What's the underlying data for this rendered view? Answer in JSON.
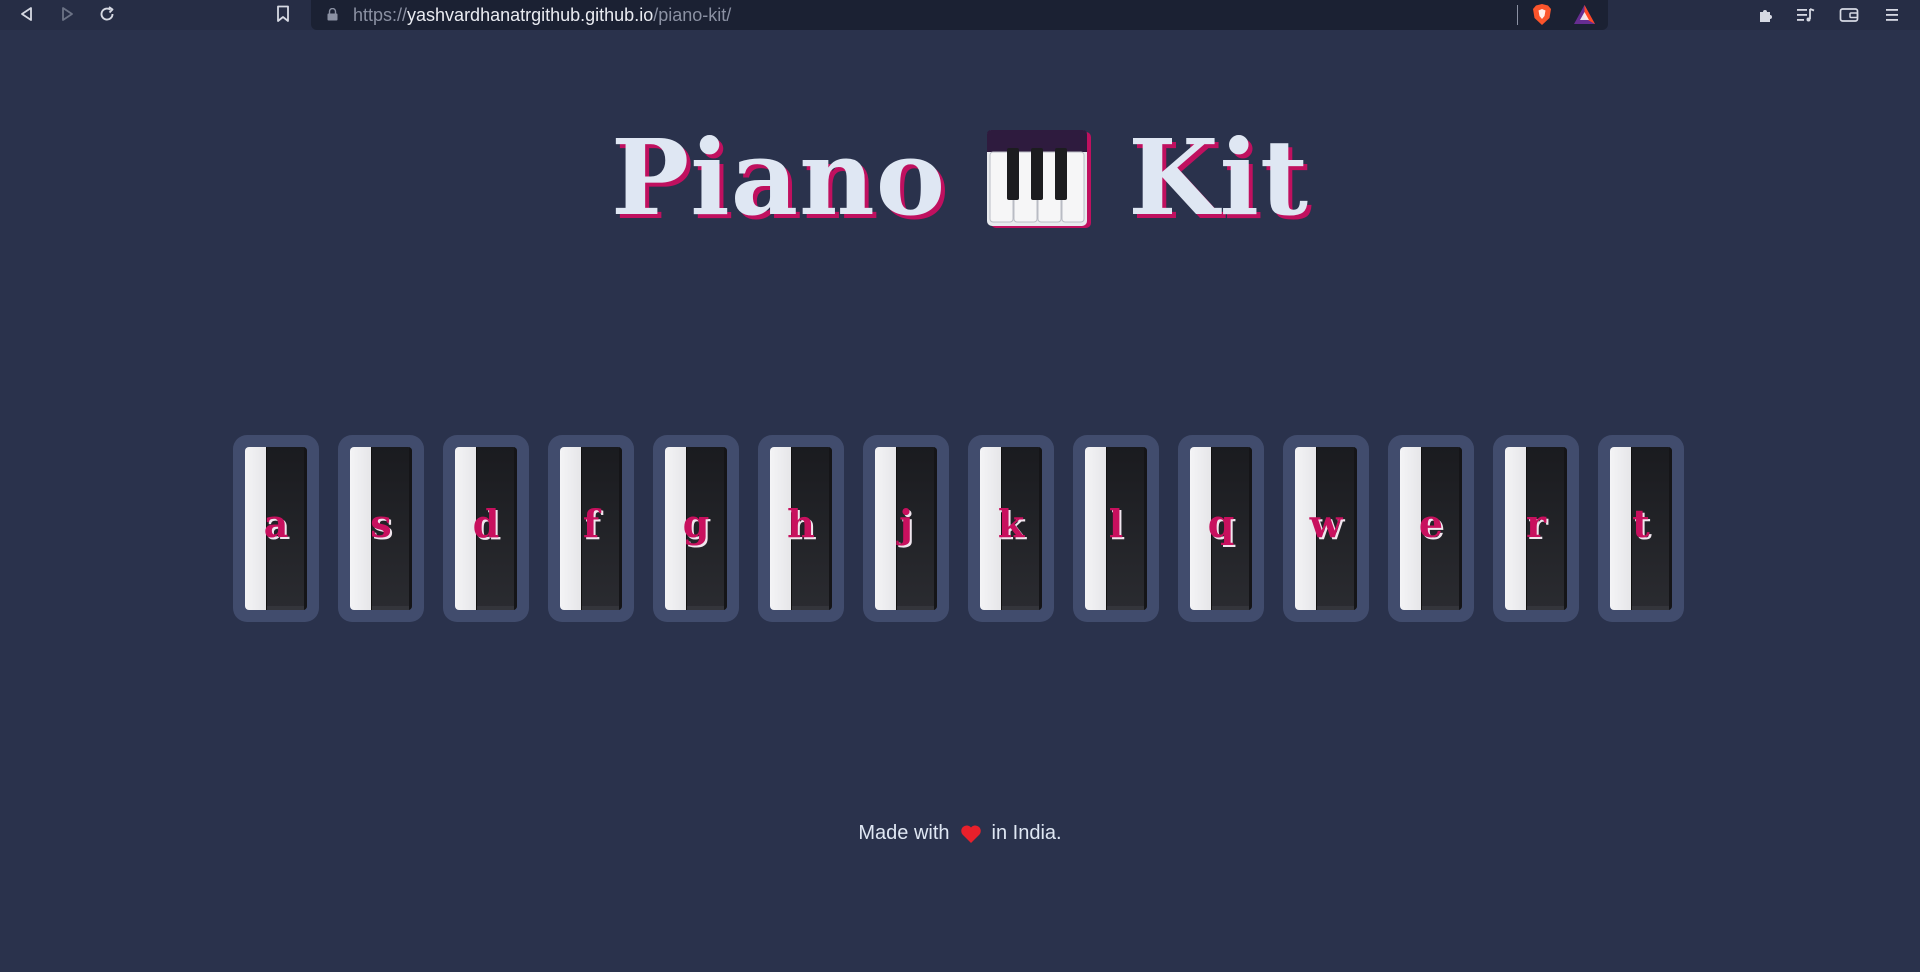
{
  "browser": {
    "url_scheme": "https://",
    "url_host": "yashvardhanatrgithub.github.io",
    "url_path": "/piano-kit/",
    "icons": {
      "back": "back-icon",
      "forward": "forward-icon",
      "reload": "reload-icon",
      "bookmark": "bookmark-icon",
      "lock": "lock-icon",
      "brave": "brave-shields-icon",
      "rewards": "brave-rewards-icon",
      "extensions": "extensions-icon",
      "playlist": "playlist-icon",
      "wallet": "wallet-icon",
      "menu": "menu-icon"
    }
  },
  "page": {
    "title_left": "Piano",
    "title_emoji": "musical-keyboard-emoji",
    "title_right": "Kit",
    "keys": [
      {
        "label": "a"
      },
      {
        "label": "s"
      },
      {
        "label": "d"
      },
      {
        "label": "f"
      },
      {
        "label": "g"
      },
      {
        "label": "h"
      },
      {
        "label": "j"
      },
      {
        "label": "k"
      },
      {
        "label": "l"
      },
      {
        "label": "q"
      },
      {
        "label": "w"
      },
      {
        "label": "e"
      },
      {
        "label": "r"
      },
      {
        "label": "t"
      }
    ],
    "footer_before": "Made with",
    "footer_icon": "heart-icon",
    "footer_after": "in India."
  },
  "colors": {
    "background": "#2a324c",
    "accent": "#c8105e",
    "title_text": "#dfe7f3",
    "key_frame": "#414c6d"
  }
}
